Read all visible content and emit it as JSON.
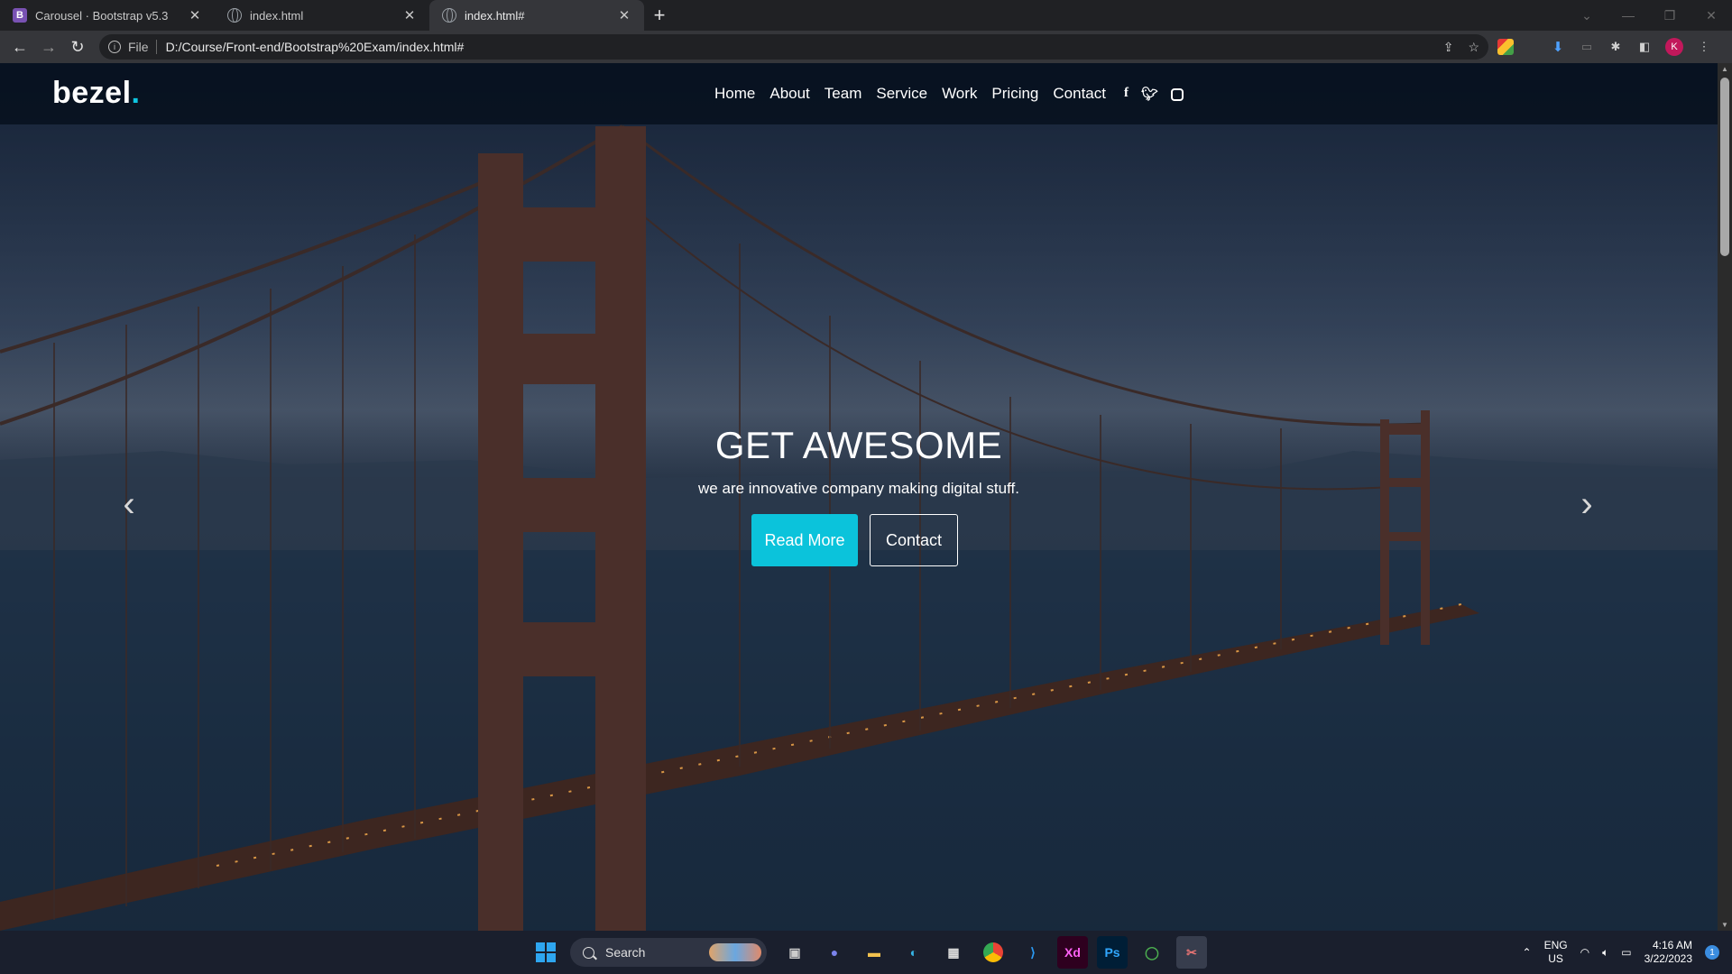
{
  "browser": {
    "tabs": [
      {
        "title": "Carousel · Bootstrap v5.3",
        "favicon": "bootstrap-icon",
        "active": false
      },
      {
        "title": "index.html",
        "favicon": "globe-icon",
        "active": false
      },
      {
        "title": "index.html#",
        "favicon": "globe-icon",
        "active": true
      }
    ],
    "scheme_label": "File",
    "url": "D:/Course/Front-end/Bootstrap%20Exam/index.html#",
    "avatar_letter": "K"
  },
  "page": {
    "logo_text": "bezel",
    "logo_dot": ".",
    "nav": [
      "Home",
      "About",
      "Team",
      "Service",
      "Work",
      "Pricing",
      "Contact"
    ],
    "social": [
      "facebook-icon",
      "twitter-icon",
      "instagram-icon"
    ],
    "hero_title": "GET AWESOME",
    "hero_subtitle": "we are innovative company making digital stuff.",
    "btn_primary": "Read More",
    "btn_secondary": "Contact",
    "accent_color": "#0bc3db"
  },
  "taskbar": {
    "search_label": "Search",
    "apps": [
      "file-explorer-icon",
      "teams-icon",
      "folder-icon",
      "edge-icon",
      "store-icon",
      "chrome-icon",
      "vscode-icon",
      "Xd",
      "Ps",
      "quicktime-icon",
      "snipping-tool-icon"
    ],
    "lang_top": "ENG",
    "lang_bottom": "US",
    "time": "4:16 AM",
    "date": "3/22/2023",
    "notifications": "1"
  }
}
